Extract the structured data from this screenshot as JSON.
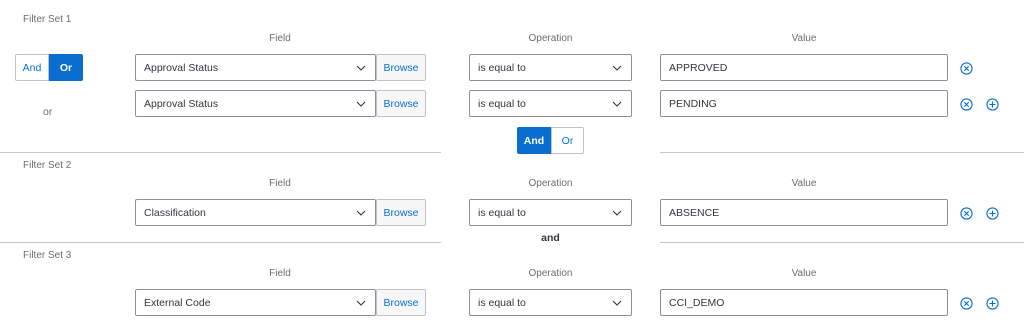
{
  "column_headers": {
    "field": "Field",
    "operation": "Operation",
    "value": "Value"
  },
  "browse_label": "Browse",
  "colors": {
    "accent": "#0a6ed1",
    "border": "#89919a",
    "text": "#32363a",
    "muted": "#6a6d70"
  },
  "sets": [
    {
      "title": "Filter Set 1",
      "toggle": {
        "options": [
          "And",
          "Or"
        ],
        "selected": "Or"
      },
      "row_conjunction": "or",
      "rows": [
        {
          "field": "Approval Status",
          "operation": "is equal to",
          "value": "APPROVED",
          "icons": [
            "remove-icon"
          ]
        },
        {
          "field": "Approval Status",
          "operation": "is equal to",
          "value": "PENDING",
          "icons": [
            "remove-icon",
            "add-icon"
          ]
        }
      ]
    },
    {
      "title": "Filter Set 2",
      "rows": [
        {
          "field": "Classification",
          "operation": "is equal to",
          "value": "ABSENCE",
          "icons": [
            "remove-icon",
            "add-icon"
          ]
        }
      ]
    },
    {
      "title": "Filter Set 3",
      "rows": [
        {
          "field": "External Code",
          "operation": "is equal to",
          "value": "CCI_DEMO",
          "icons": [
            "remove-icon",
            "add-icon"
          ]
        }
      ]
    }
  ],
  "set_conjunctions": [
    {
      "type": "toggle",
      "options": [
        "And",
        "Or"
      ],
      "selected": "And"
    },
    {
      "type": "label",
      "label": "and"
    }
  ]
}
